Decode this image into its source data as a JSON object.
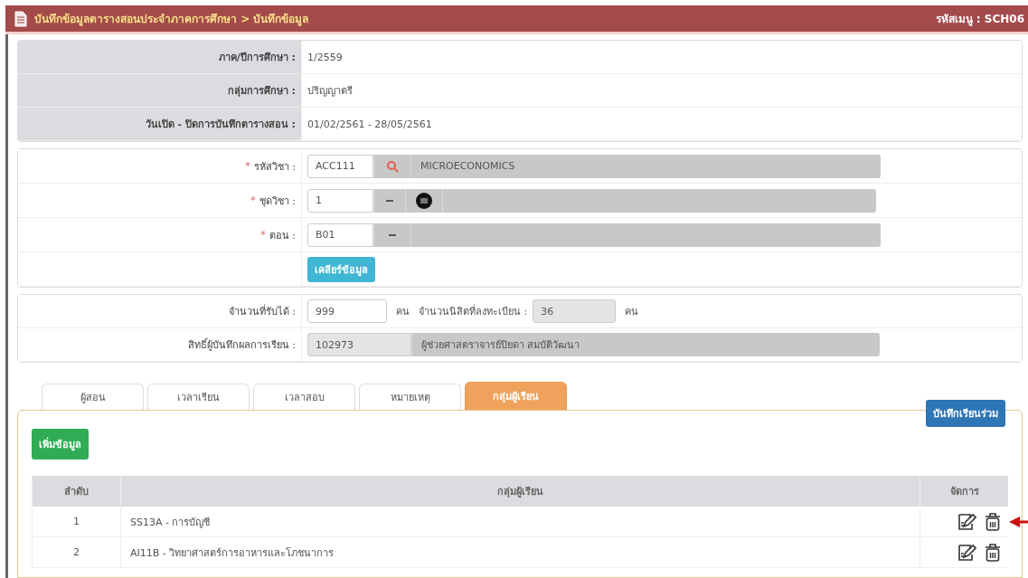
{
  "header": {
    "title": "บันทึกข้อมูลตารางสอนประจำภาคการศึกษา > บันทึกข้อมูล",
    "menu_code": "รหัสเมนู : SCH06"
  },
  "info": [
    {
      "label": "ภาค/ปีการศึกษา :",
      "value": "1/2559"
    },
    {
      "label": "กลุ่มการศึกษา :",
      "value": "ปริญญาตรี"
    },
    {
      "label": "วันเปิด - ปิดการบันทึกตารางสอน :",
      "value": "01/02/2561 - 28/05/2561"
    }
  ],
  "course_form": {
    "required_mark": "*",
    "subject": {
      "label": "รหัสวิชา :",
      "value": "ACC111",
      "name": "MICROECONOMICS"
    },
    "subject_set": {
      "label": "ชุดวิชา :",
      "value": "1"
    },
    "section": {
      "label": "ตอน :",
      "value": "B01"
    },
    "clear_button": "เคลียร์ข้อมูล"
  },
  "capacity": {
    "label": "จำนวนที่รับได้ :",
    "value": "999",
    "unit": "คน",
    "enrolled_label": "จำนวนนิสิตที่ลงทะเบียน :",
    "enrolled_value": "36",
    "enrolled_unit": "คน"
  },
  "grader": {
    "label": "สิทธิ์ผู้บันทึกผลการเรียน :",
    "id": "102973",
    "name": "ผู้ช่วยศาสตราจารย์ปิยดา สมบัติวัฒนา"
  },
  "tabs": [
    {
      "label": "ผู้สอน",
      "selected": false
    },
    {
      "label": "เวลาเรียน",
      "selected": false
    },
    {
      "label": "เวลาสอบ",
      "selected": false
    },
    {
      "label": "หมายเหตุ",
      "selected": false
    },
    {
      "label": "กลุ่มผู้เรียน",
      "selected": true
    }
  ],
  "panel": {
    "add_button": "เพิ่มข้อมูล",
    "joint_button": "บันทึกเรียนร่วม",
    "table": {
      "columns": [
        "ลำดับ",
        "กลุ่มผู้เรียน",
        "จัดการ"
      ],
      "rows": [
        {
          "index": "1",
          "group": "SS13A - การบัญชี",
          "pointed": true
        },
        {
          "index": "2",
          "group": "AI11B - วิทยาศาสตร์การอาหารและโภชนาการ",
          "pointed": false
        }
      ]
    }
  }
}
